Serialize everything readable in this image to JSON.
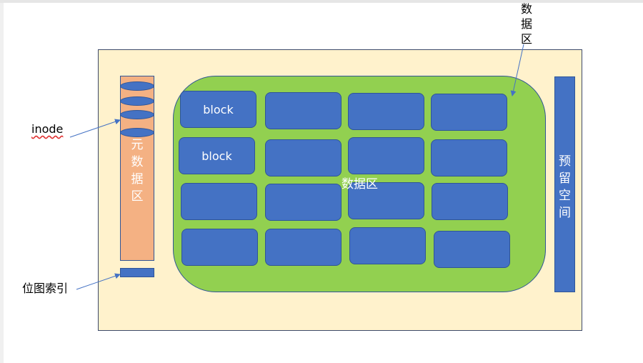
{
  "metadata_area": {
    "label": "元\n数\n据\n区"
  },
  "data_area": {
    "label": "数据区"
  },
  "reserved_area": {
    "label": "预\n留\n空\n间"
  },
  "annotations": {
    "inode": "inode",
    "bitmap_index": "位图索引",
    "data_area": "数\n据\n区"
  },
  "blocks": [
    {
      "label": "block"
    },
    {
      "label": ""
    },
    {
      "label": ""
    },
    {
      "label": ""
    },
    {
      "label": "block"
    },
    {
      "label": ""
    },
    {
      "label": ""
    },
    {
      "label": ""
    },
    {
      "label": ""
    },
    {
      "label": ""
    },
    {
      "label": ""
    },
    {
      "label": ""
    },
    {
      "label": ""
    },
    {
      "label": ""
    },
    {
      "label": ""
    },
    {
      "label": ""
    }
  ],
  "colors": {
    "canvas": "#fff2cc",
    "metadata": "#f4b183",
    "data_area": "#92d050",
    "block": "#4472c4",
    "arrow": "#4472c4"
  }
}
